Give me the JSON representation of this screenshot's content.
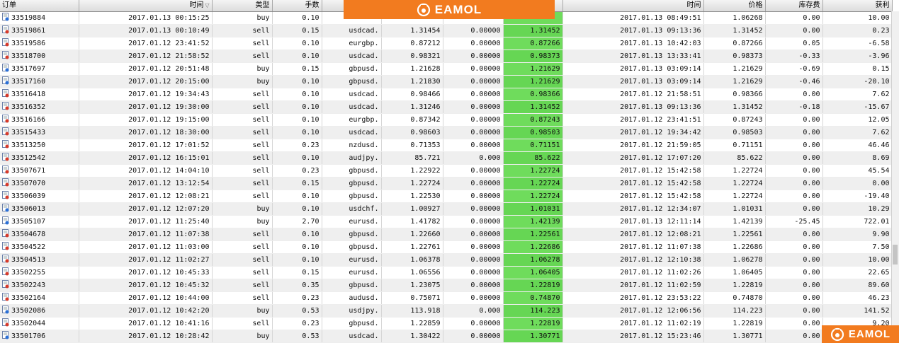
{
  "headers": {
    "ticket": "订单",
    "open_time": "时间",
    "type": "类型",
    "lots": "手数",
    "symbol": "",
    "open_price": "",
    "sl": "",
    "close_price": "",
    "close_time": "时间",
    "price": "价格",
    "swap": "库存费",
    "profit": "获利"
  },
  "brand": {
    "name": "EAMOL"
  },
  "colors": {
    "brand": "#f27b1f",
    "close_highlight": "#6fdc5c"
  },
  "rows": [
    {
      "ticket": "33519884",
      "open_time": "2017.01.13 00:15:25",
      "type": "buy",
      "lots": "0.10",
      "symbol": "",
      "open_price": "",
      "sl": "",
      "close_price": "",
      "close_time": "2017.01.13 08:49:51",
      "price": "1.06268",
      "swap": "0.00",
      "profit": "10.00"
    },
    {
      "ticket": "33519861",
      "open_time": "2017.01.13 00:10:49",
      "type": "sell",
      "lots": "0.15",
      "symbol": "usdcad.",
      "open_price": "1.31454",
      "sl": "0.00000",
      "close_price": "1.31452",
      "close_time": "2017.01.13 09:13:36",
      "price": "1.31452",
      "swap": "0.00",
      "profit": "0.23"
    },
    {
      "ticket": "33519586",
      "open_time": "2017.01.12 23:41:52",
      "type": "sell",
      "lots": "0.10",
      "symbol": "eurgbp.",
      "open_price": "0.87212",
      "sl": "0.00000",
      "close_price": "0.87266",
      "close_time": "2017.01.13 10:42:03",
      "price": "0.87266",
      "swap": "0.05",
      "profit": "-6.58"
    },
    {
      "ticket": "33518700",
      "open_time": "2017.01.12 21:58:52",
      "type": "sell",
      "lots": "0.10",
      "symbol": "usdcad.",
      "open_price": "0.98321",
      "sl": "0.00000",
      "close_price": "0.98373",
      "close_time": "2017.01.13 13:33:41",
      "price": "0.98373",
      "swap": "-0.33",
      "profit": "-3.96"
    },
    {
      "ticket": "33517697",
      "open_time": "2017.01.12 20:51:48",
      "type": "buy",
      "lots": "0.15",
      "symbol": "gbpusd.",
      "open_price": "1.21628",
      "sl": "0.00000",
      "close_price": "1.21629",
      "close_time": "2017.01.13 03:09:14",
      "price": "1.21629",
      "swap": "-0.69",
      "profit": "0.15"
    },
    {
      "ticket": "33517160",
      "open_time": "2017.01.12 20:15:00",
      "type": "buy",
      "lots": "0.10",
      "symbol": "gbpusd.",
      "open_price": "1.21830",
      "sl": "0.00000",
      "close_price": "1.21629",
      "close_time": "2017.01.13 03:09:14",
      "price": "1.21629",
      "swap": "-0.46",
      "profit": "-20.10"
    },
    {
      "ticket": "33516418",
      "open_time": "2017.01.12 19:34:43",
      "type": "sell",
      "lots": "0.10",
      "symbol": "usdcad.",
      "open_price": "0.98466",
      "sl": "0.00000",
      "close_price": "0.98366",
      "close_time": "2017.01.12 21:58:51",
      "price": "0.98366",
      "swap": "0.00",
      "profit": "7.62"
    },
    {
      "ticket": "33516352",
      "open_time": "2017.01.12 19:30:00",
      "type": "sell",
      "lots": "0.10",
      "symbol": "usdcad.",
      "open_price": "1.31246",
      "sl": "0.00000",
      "close_price": "1.31452",
      "close_time": "2017.01.13 09:13:36",
      "price": "1.31452",
      "swap": "-0.18",
      "profit": "-15.67"
    },
    {
      "ticket": "33516166",
      "open_time": "2017.01.12 19:15:00",
      "type": "sell",
      "lots": "0.10",
      "symbol": "eurgbp.",
      "open_price": "0.87342",
      "sl": "0.00000",
      "close_price": "0.87243",
      "close_time": "2017.01.12 23:41:51",
      "price": "0.87243",
      "swap": "0.00",
      "profit": "12.05"
    },
    {
      "ticket": "33515433",
      "open_time": "2017.01.12 18:30:00",
      "type": "sell",
      "lots": "0.10",
      "symbol": "usdcad.",
      "open_price": "0.98603",
      "sl": "0.00000",
      "close_price": "0.98503",
      "close_time": "2017.01.12 19:34:42",
      "price": "0.98503",
      "swap": "0.00",
      "profit": "7.62"
    },
    {
      "ticket": "33513250",
      "open_time": "2017.01.12 17:01:52",
      "type": "sell",
      "lots": "0.23",
      "symbol": "nzdusd.",
      "open_price": "0.71353",
      "sl": "0.00000",
      "close_price": "0.71151",
      "close_time": "2017.01.12 21:59:05",
      "price": "0.71151",
      "swap": "0.00",
      "profit": "46.46"
    },
    {
      "ticket": "33512542",
      "open_time": "2017.01.12 16:15:01",
      "type": "sell",
      "lots": "0.10",
      "symbol": "audjpy.",
      "open_price": "85.721",
      "sl": "0.000",
      "close_price": "85.622",
      "close_time": "2017.01.12 17:07:20",
      "price": "85.622",
      "swap": "0.00",
      "profit": "8.69"
    },
    {
      "ticket": "33507671",
      "open_time": "2017.01.12 14:04:10",
      "type": "sell",
      "lots": "0.23",
      "symbol": "gbpusd.",
      "open_price": "1.22922",
      "sl": "0.00000",
      "close_price": "1.22724",
      "close_time": "2017.01.12 15:42:58",
      "price": "1.22724",
      "swap": "0.00",
      "profit": "45.54"
    },
    {
      "ticket": "33507070",
      "open_time": "2017.01.12 13:12:54",
      "type": "sell",
      "lots": "0.15",
      "symbol": "gbpusd.",
      "open_price": "1.22724",
      "sl": "0.00000",
      "close_price": "1.22724",
      "close_time": "2017.01.12 15:42:58",
      "price": "1.22724",
      "swap": "0.00",
      "profit": "0.00"
    },
    {
      "ticket": "33506039",
      "open_time": "2017.01.12 12:08:21",
      "type": "sell",
      "lots": "0.10",
      "symbol": "gbpusd.",
      "open_price": "1.22530",
      "sl": "0.00000",
      "close_price": "1.22724",
      "close_time": "2017.01.12 15:42:58",
      "price": "1.22724",
      "swap": "0.00",
      "profit": "-19.40"
    },
    {
      "ticket": "33506013",
      "open_time": "2017.01.12 12:07:20",
      "type": "buy",
      "lots": "0.10",
      "symbol": "usdchf.",
      "open_price": "1.00927",
      "sl": "0.00000",
      "close_price": "1.01031",
      "close_time": "2017.01.12 12:34:07",
      "price": "1.01031",
      "swap": "0.00",
      "profit": "10.29"
    },
    {
      "ticket": "33505107",
      "open_time": "2017.01.12 11:25:40",
      "type": "buy",
      "lots": "2.70",
      "symbol": "eurusd.",
      "open_price": "1.41782",
      "sl": "0.00000",
      "close_price": "1.42139",
      "close_time": "2017.01.13 12:11:14",
      "price": "1.42139",
      "swap": "-25.45",
      "profit": "722.01"
    },
    {
      "ticket": "33504678",
      "open_time": "2017.01.12 11:07:38",
      "type": "sell",
      "lots": "0.10",
      "symbol": "gbpusd.",
      "open_price": "1.22660",
      "sl": "0.00000",
      "close_price": "1.22561",
      "close_time": "2017.01.12 12:08:21",
      "price": "1.22561",
      "swap": "0.00",
      "profit": "9.90"
    },
    {
      "ticket": "33504522",
      "open_time": "2017.01.12 11:03:00",
      "type": "sell",
      "lots": "0.10",
      "symbol": "gbpusd.",
      "open_price": "1.22761",
      "sl": "0.00000",
      "close_price": "1.22686",
      "close_time": "2017.01.12 11:07:38",
      "price": "1.22686",
      "swap": "0.00",
      "profit": "7.50"
    },
    {
      "ticket": "33504513",
      "open_time": "2017.01.12 11:02:27",
      "type": "sell",
      "lots": "0.10",
      "symbol": "eurusd.",
      "open_price": "1.06378",
      "sl": "0.00000",
      "close_price": "1.06278",
      "close_time": "2017.01.12 12:10:38",
      "price": "1.06278",
      "swap": "0.00",
      "profit": "10.00"
    },
    {
      "ticket": "33502255",
      "open_time": "2017.01.12 10:45:33",
      "type": "sell",
      "lots": "0.15",
      "symbol": "eurusd.",
      "open_price": "1.06556",
      "sl": "0.00000",
      "close_price": "1.06405",
      "close_time": "2017.01.12 11:02:26",
      "price": "1.06405",
      "swap": "0.00",
      "profit": "22.65"
    },
    {
      "ticket": "33502243",
      "open_time": "2017.01.12 10:45:32",
      "type": "sell",
      "lots": "0.35",
      "symbol": "gbpusd.",
      "open_price": "1.23075",
      "sl": "0.00000",
      "close_price": "1.22819",
      "close_time": "2017.01.12 11:02:59",
      "price": "1.22819",
      "swap": "0.00",
      "profit": "89.60"
    },
    {
      "ticket": "33502164",
      "open_time": "2017.01.12 10:44:00",
      "type": "sell",
      "lots": "0.23",
      "symbol": "audusd.",
      "open_price": "0.75071",
      "sl": "0.00000",
      "close_price": "0.74870",
      "close_time": "2017.01.12 23:53:22",
      "price": "0.74870",
      "swap": "0.00",
      "profit": "46.23"
    },
    {
      "ticket": "33502086",
      "open_time": "2017.01.12 10:42:20",
      "type": "buy",
      "lots": "0.53",
      "symbol": "usdjpy.",
      "open_price": "113.918",
      "sl": "0.000",
      "close_price": "114.223",
      "close_time": "2017.01.12 12:06:56",
      "price": "114.223",
      "swap": "0.00",
      "profit": "141.52"
    },
    {
      "ticket": "33502044",
      "open_time": "2017.01.12 10:41:16",
      "type": "sell",
      "lots": "0.23",
      "symbol": "gbpusd.",
      "open_price": "1.22859",
      "sl": "0.00000",
      "close_price": "1.22819",
      "close_time": "2017.01.12 11:02:19",
      "price": "1.22819",
      "swap": "0.00",
      "profit": "9.20"
    },
    {
      "ticket": "33501706",
      "open_time": "2017.01.12 10:28:42",
      "type": "buy",
      "lots": "0.53",
      "symbol": "usdcad.",
      "open_price": "1.30422",
      "sl": "0.00000",
      "close_price": "1.30771",
      "close_time": "2017.01.12 15:23:46",
      "price": "1.30771",
      "swap": "0.00",
      "profit": ""
    }
  ]
}
